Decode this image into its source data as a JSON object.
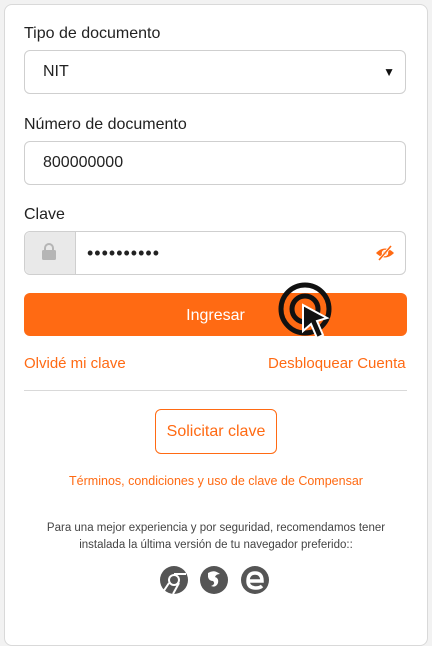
{
  "colors": {
    "accent": "#ff6a13",
    "lock_bg": "#e9e9e9"
  },
  "doc_type": {
    "label": "Tipo de documento",
    "value": "NIT"
  },
  "doc_number": {
    "label": "Número de documento",
    "value": "800000000"
  },
  "password": {
    "label": "Clave",
    "value": "••••••••••",
    "icons": [
      "lock-icon",
      "eye-toggle-icon"
    ]
  },
  "buttons": {
    "login": "Ingresar",
    "request_key": "Solicitar clave"
  },
  "links": {
    "forgot": "Olvidé mi clave",
    "unlock": "Desbloquear Cuenta",
    "terms": "Términos, condiciones y uso de clave de Compensar"
  },
  "recommendation": {
    "line1": "Para una mejor experiencia y por seguridad, recomendamos tener",
    "line2": "instalada la última versión de tu navegador preferido::"
  },
  "browser_icons": [
    "chrome-icon",
    "firefox-icon",
    "edge-icon"
  ]
}
